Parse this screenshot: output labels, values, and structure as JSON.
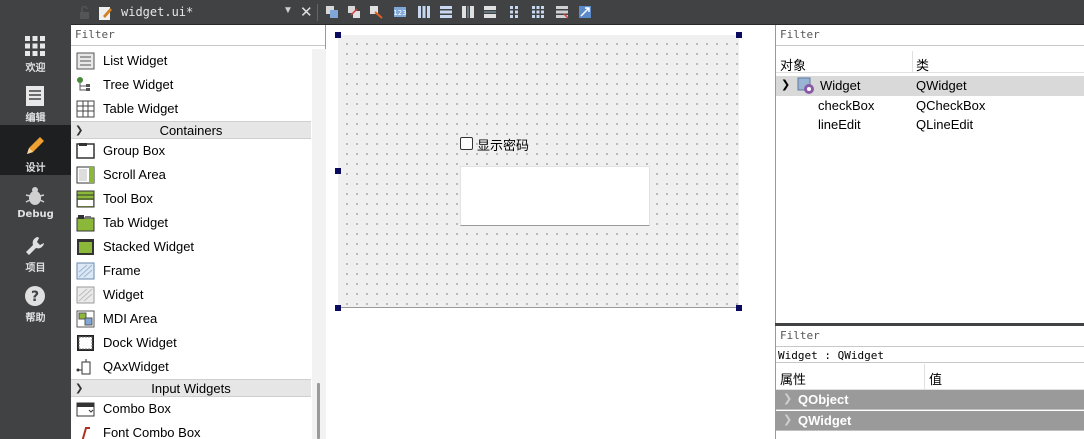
{
  "modebar": {
    "items": [
      {
        "label": "欢迎",
        "icon": "grid-icon"
      },
      {
        "label": "编辑",
        "icon": "document-icon"
      },
      {
        "label": "设计",
        "icon": "pencil-icon"
      },
      {
        "label": "Debug",
        "icon": "bug-icon"
      },
      {
        "label": "项目",
        "icon": "wrench-icon"
      },
      {
        "label": "帮助",
        "icon": "help-icon"
      }
    ],
    "active_index": 2
  },
  "toolbar": {
    "document_title": "widget.ui*"
  },
  "widget_box": {
    "filter_placeholder": "Filter",
    "items_top": [
      "List Widget",
      "Tree Widget",
      "Table Widget"
    ],
    "containers_label": "Containers",
    "containers": [
      "Group Box",
      "Scroll Area",
      "Tool Box",
      "Tab Widget",
      "Stacked Widget",
      "Frame",
      "Widget",
      "MDI Area",
      "Dock Widget",
      "QAxWidget"
    ],
    "input_label": "Input Widgets",
    "inputs": [
      "Combo Box",
      "Font Combo Box"
    ]
  },
  "form": {
    "checkbox_label": "显示密码",
    "checkbox_checked": false,
    "line_edit_value": ""
  },
  "object_inspector": {
    "filter_placeholder": "Filter",
    "col_object": "对象",
    "col_class": "类",
    "rows": [
      {
        "name": "Widget",
        "cls": "QWidget"
      },
      {
        "name": "checkBox",
        "cls": "QCheckBox"
      },
      {
        "name": "lineEdit",
        "cls": "QLineEdit"
      }
    ]
  },
  "property_editor": {
    "filter_placeholder": "Filter",
    "title": "Widget : QWidget",
    "col_property": "属性",
    "col_value": "值",
    "groups": [
      "QObject",
      "QWidget"
    ]
  },
  "colors": {
    "modebar_bg": "#404244",
    "modebar_active": "#1e1f20",
    "selection_handle": "#0a0a60",
    "group_header": "#9a9a9a"
  }
}
